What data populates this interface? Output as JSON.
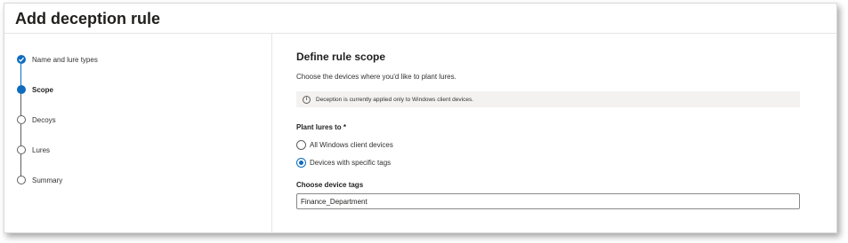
{
  "page": {
    "title": "Add deception rule"
  },
  "stepper": {
    "steps": [
      {
        "label": "Name and lure types",
        "state": "completed",
        "icon": "checkmark-icon"
      },
      {
        "label": "Scope",
        "state": "current"
      },
      {
        "label": "Decoys",
        "state": "pending"
      },
      {
        "label": "Lures",
        "state": "pending"
      },
      {
        "label": "Summary",
        "state": "pending"
      }
    ]
  },
  "scope": {
    "title": "Define rule scope",
    "description": "Choose the devices where you'd like to plant lures.",
    "info_icon": "info-icon",
    "info_message": "Deception is currently applied only to Windows client devices.",
    "plant_label": "Plant lures to *",
    "options": [
      {
        "label": "All Windows client devices",
        "selected": false
      },
      {
        "label": "Devices with specific tags",
        "selected": true
      }
    ],
    "tags_label": "Choose device tags",
    "tags_value": "Finance_Department"
  },
  "colors": {
    "accent": "#0f6cbd",
    "text": "#323130",
    "info_background": "#f3f2f1",
    "border": "#8a8886"
  }
}
